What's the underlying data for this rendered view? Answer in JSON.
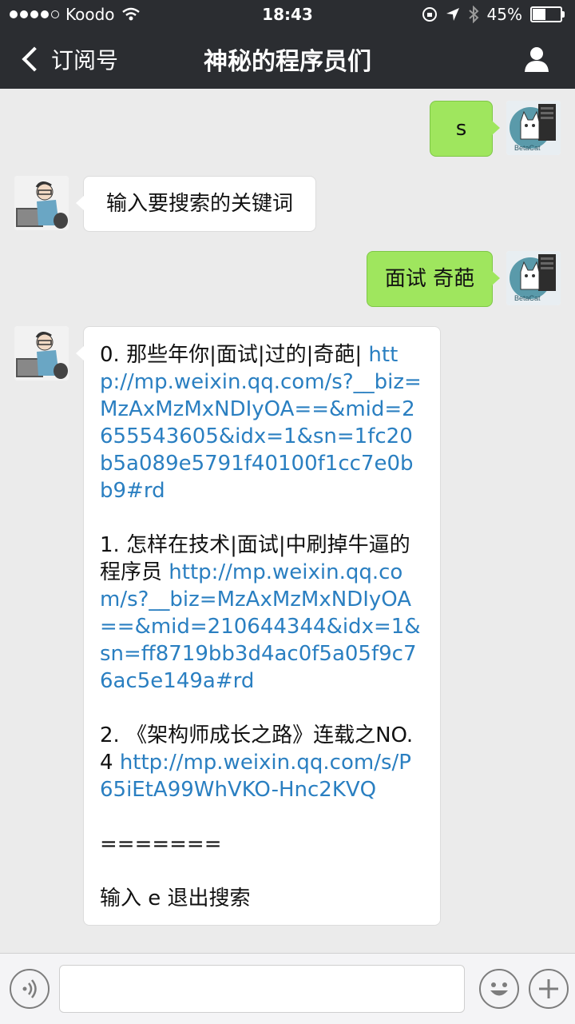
{
  "status": {
    "carrier": "Koodo",
    "time": "18:43",
    "battery": "45%",
    "battery_level": 0.45
  },
  "nav": {
    "back_label": "订阅号",
    "title": "神秘的程序员们"
  },
  "messages": [
    {
      "from": "me",
      "text": "s"
    },
    {
      "from": "bot",
      "text": "输入要搜索的关键词"
    },
    {
      "from": "me",
      "text": "面试 奇葩"
    },
    {
      "from": "bot",
      "items": [
        {
          "text": "0. 那些年你|面试|过的|奇葩| ",
          "link": "http://mp.weixin.qq.com/s?__biz=MzAxMzMxNDIyOA==&mid=2655543605&idx=1&sn=1fc20b5a089e5791f40100f1cc7e0bb9#rd"
        },
        {
          "text": "1. 怎样在技术|面试|中刷掉牛逼的程序员 ",
          "link": "http://mp.weixin.qq.com/s?__biz=MzAxMzMxNDIyOA==&mid=210644344&idx=1&sn=ff8719bb3d4ac0f5a05f9c76ac5e149a#rd"
        },
        {
          "text": "2. 《架构师成长之路》连载之NO.4 ",
          "link": "http://mp.weixin.qq.com/s/P65iEtA99WhVKO-Hnc2KVQ"
        }
      ],
      "separator": "=======",
      "footer": "输入 e 退出搜索"
    }
  ],
  "icons": {
    "back": "chevron-left-icon",
    "profile": "person-icon",
    "voice": "voice-icon",
    "emoji": "emoji-icon",
    "plus": "plus-icon",
    "user_avatar_label": "BetaCat"
  },
  "colors": {
    "nav_bg": "#2b2d31",
    "chat_bg": "#ebebeb",
    "out_bubble": "#9fe65e",
    "link": "#2a7fc1"
  }
}
